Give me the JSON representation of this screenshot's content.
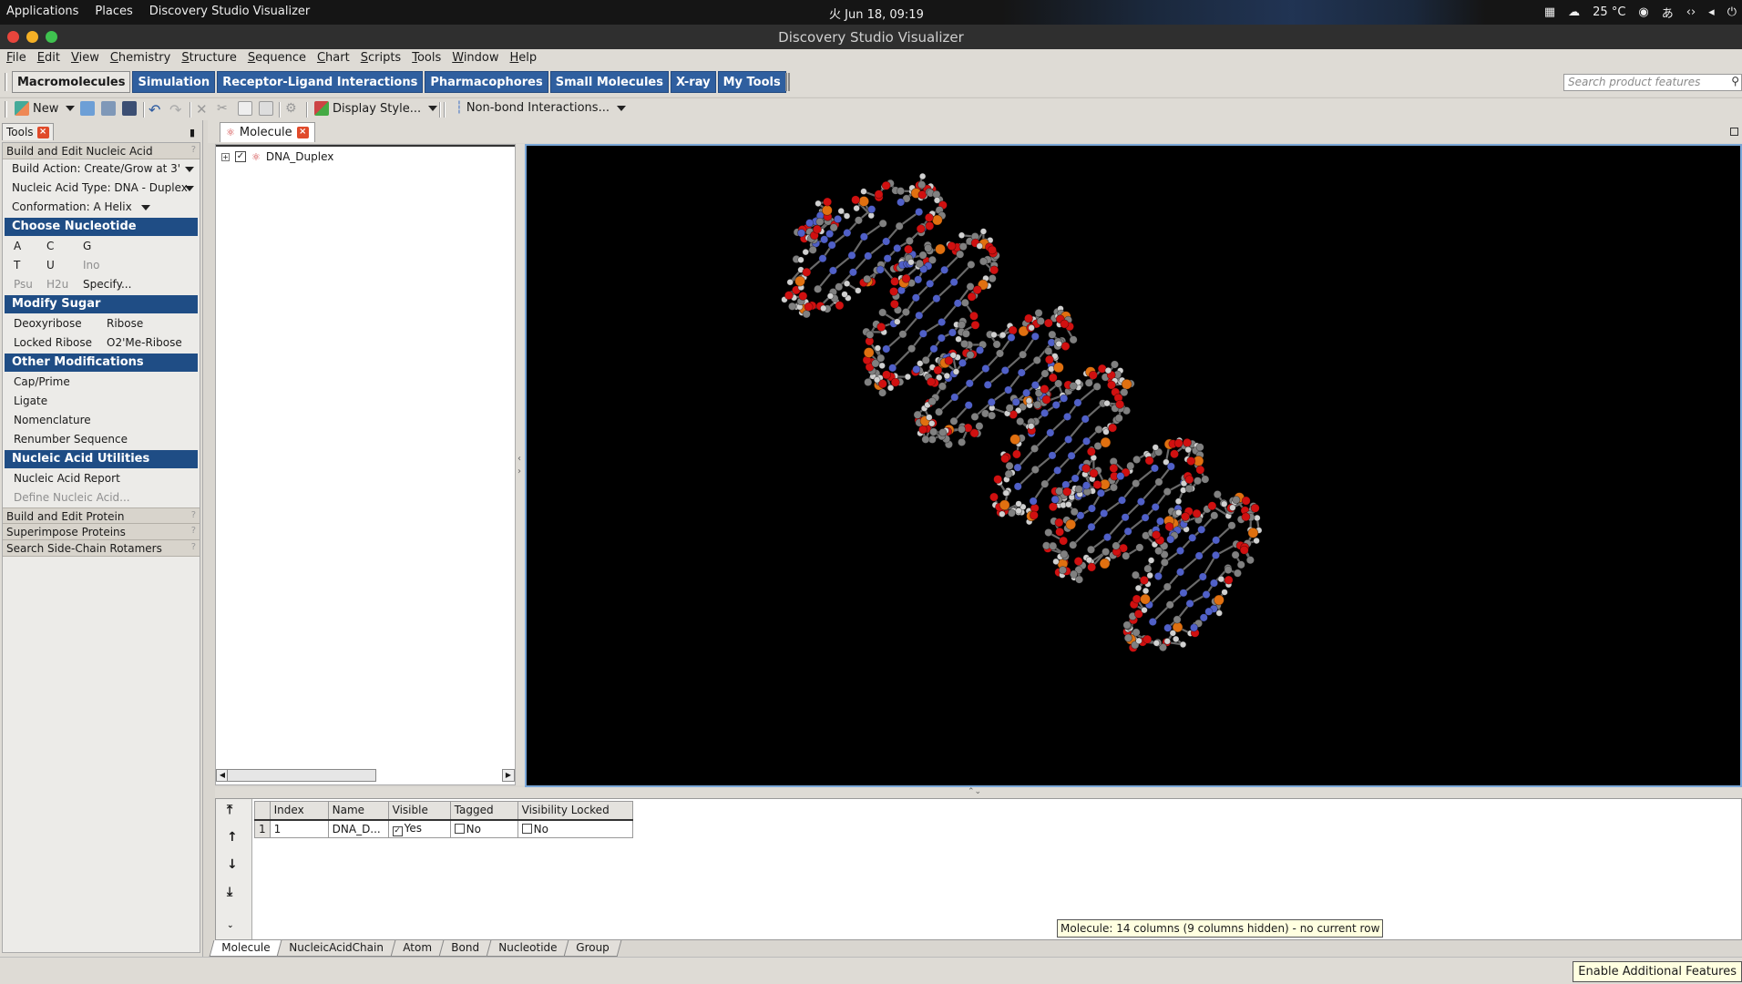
{
  "topbar": {
    "menu": [
      "Applications",
      "Places",
      "Discovery Studio Visualizer"
    ],
    "clock": "火 Jun 18, 09:19",
    "temperature": "25 °C",
    "input_method": "あ"
  },
  "window": {
    "title": "Discovery Studio Visualizer"
  },
  "menubar": [
    "File",
    "Edit",
    "View",
    "Chemistry",
    "Structure",
    "Sequence",
    "Chart",
    "Scripts",
    "Tools",
    "Window",
    "Help"
  ],
  "tool_tabs": {
    "items": [
      "Macromolecules",
      "Simulation",
      "Receptor-Ligand Interactions",
      "Pharmacophores",
      "Small Molecules",
      "X-ray",
      "My Tools"
    ],
    "active": "Macromolecules"
  },
  "search": {
    "placeholder": "Search product features"
  },
  "toolbar": {
    "new_label": "New",
    "display_style_label": "Display Style...",
    "nonbond_label": "Non-bond Interactions..."
  },
  "tools_panel": {
    "tab_label": "Tools",
    "build_edit_nucleic": "Build and Edit Nucleic Acid",
    "build_action": "Build Action: Create/Grow at 3'",
    "nucleic_type": "Nucleic Acid Type: DNA - Duplex",
    "conformation": "Conformation: A Helix",
    "choose_nucleotide": "Choose Nucleotide",
    "nucleotides_row1": [
      "A",
      "C",
      "G"
    ],
    "nucleotides_row2": [
      "T",
      "U",
      "Ino"
    ],
    "nucleotides_row3": [
      "Psu",
      "H2u",
      "Specify..."
    ],
    "modify_sugar": "Modify Sugar",
    "sugar_row1": [
      "Deoxyribose",
      "Ribose"
    ],
    "sugar_row2": [
      "Locked Ribose",
      "O2'Me-Ribose"
    ],
    "other_mods": "Other Modifications",
    "other_items": [
      "Cap/Prime",
      "Ligate",
      "Nomenclature",
      "Renumber Sequence"
    ],
    "utilities": "Nucleic Acid Utilities",
    "utility_items": [
      "Nucleic Acid Report",
      "Define Nucleic Acid..."
    ],
    "collapsed_sections": [
      "Build and Edit Protein",
      "Superimpose Proteins",
      "Search Side-Chain Rotamers"
    ]
  },
  "document": {
    "tab_label": "Molecule",
    "tree_node": "DNA_Duplex"
  },
  "data_table": {
    "columns": [
      "Index",
      "Name",
      "Visible",
      "Tagged",
      "Visibility Locked"
    ],
    "row_number": "1",
    "row": {
      "index": "1",
      "name": "DNA_D...",
      "visible": "Yes",
      "tagged": "No",
      "visibility_locked": "No"
    }
  },
  "tooltip": "Molecule: 14 columns (9 columns hidden) - no current row",
  "bottom_tabs": [
    "Molecule",
    "NucleicAcidChain",
    "Atom",
    "Bond",
    "Nucleotide",
    "Group"
  ],
  "status": {
    "enable_button": "Enable Additional Features"
  },
  "colors": {
    "tab_blue": "#2f5f9f",
    "section_blue": "#1f4d85",
    "viewer_bg": "#000000",
    "atom_oxygen": "#d01010",
    "atom_phosphorus": "#e07010",
    "atom_nitrogen": "#5060c8",
    "atom_carbon": "#808080",
    "atom_hydrogen": "#d0d0d0"
  }
}
